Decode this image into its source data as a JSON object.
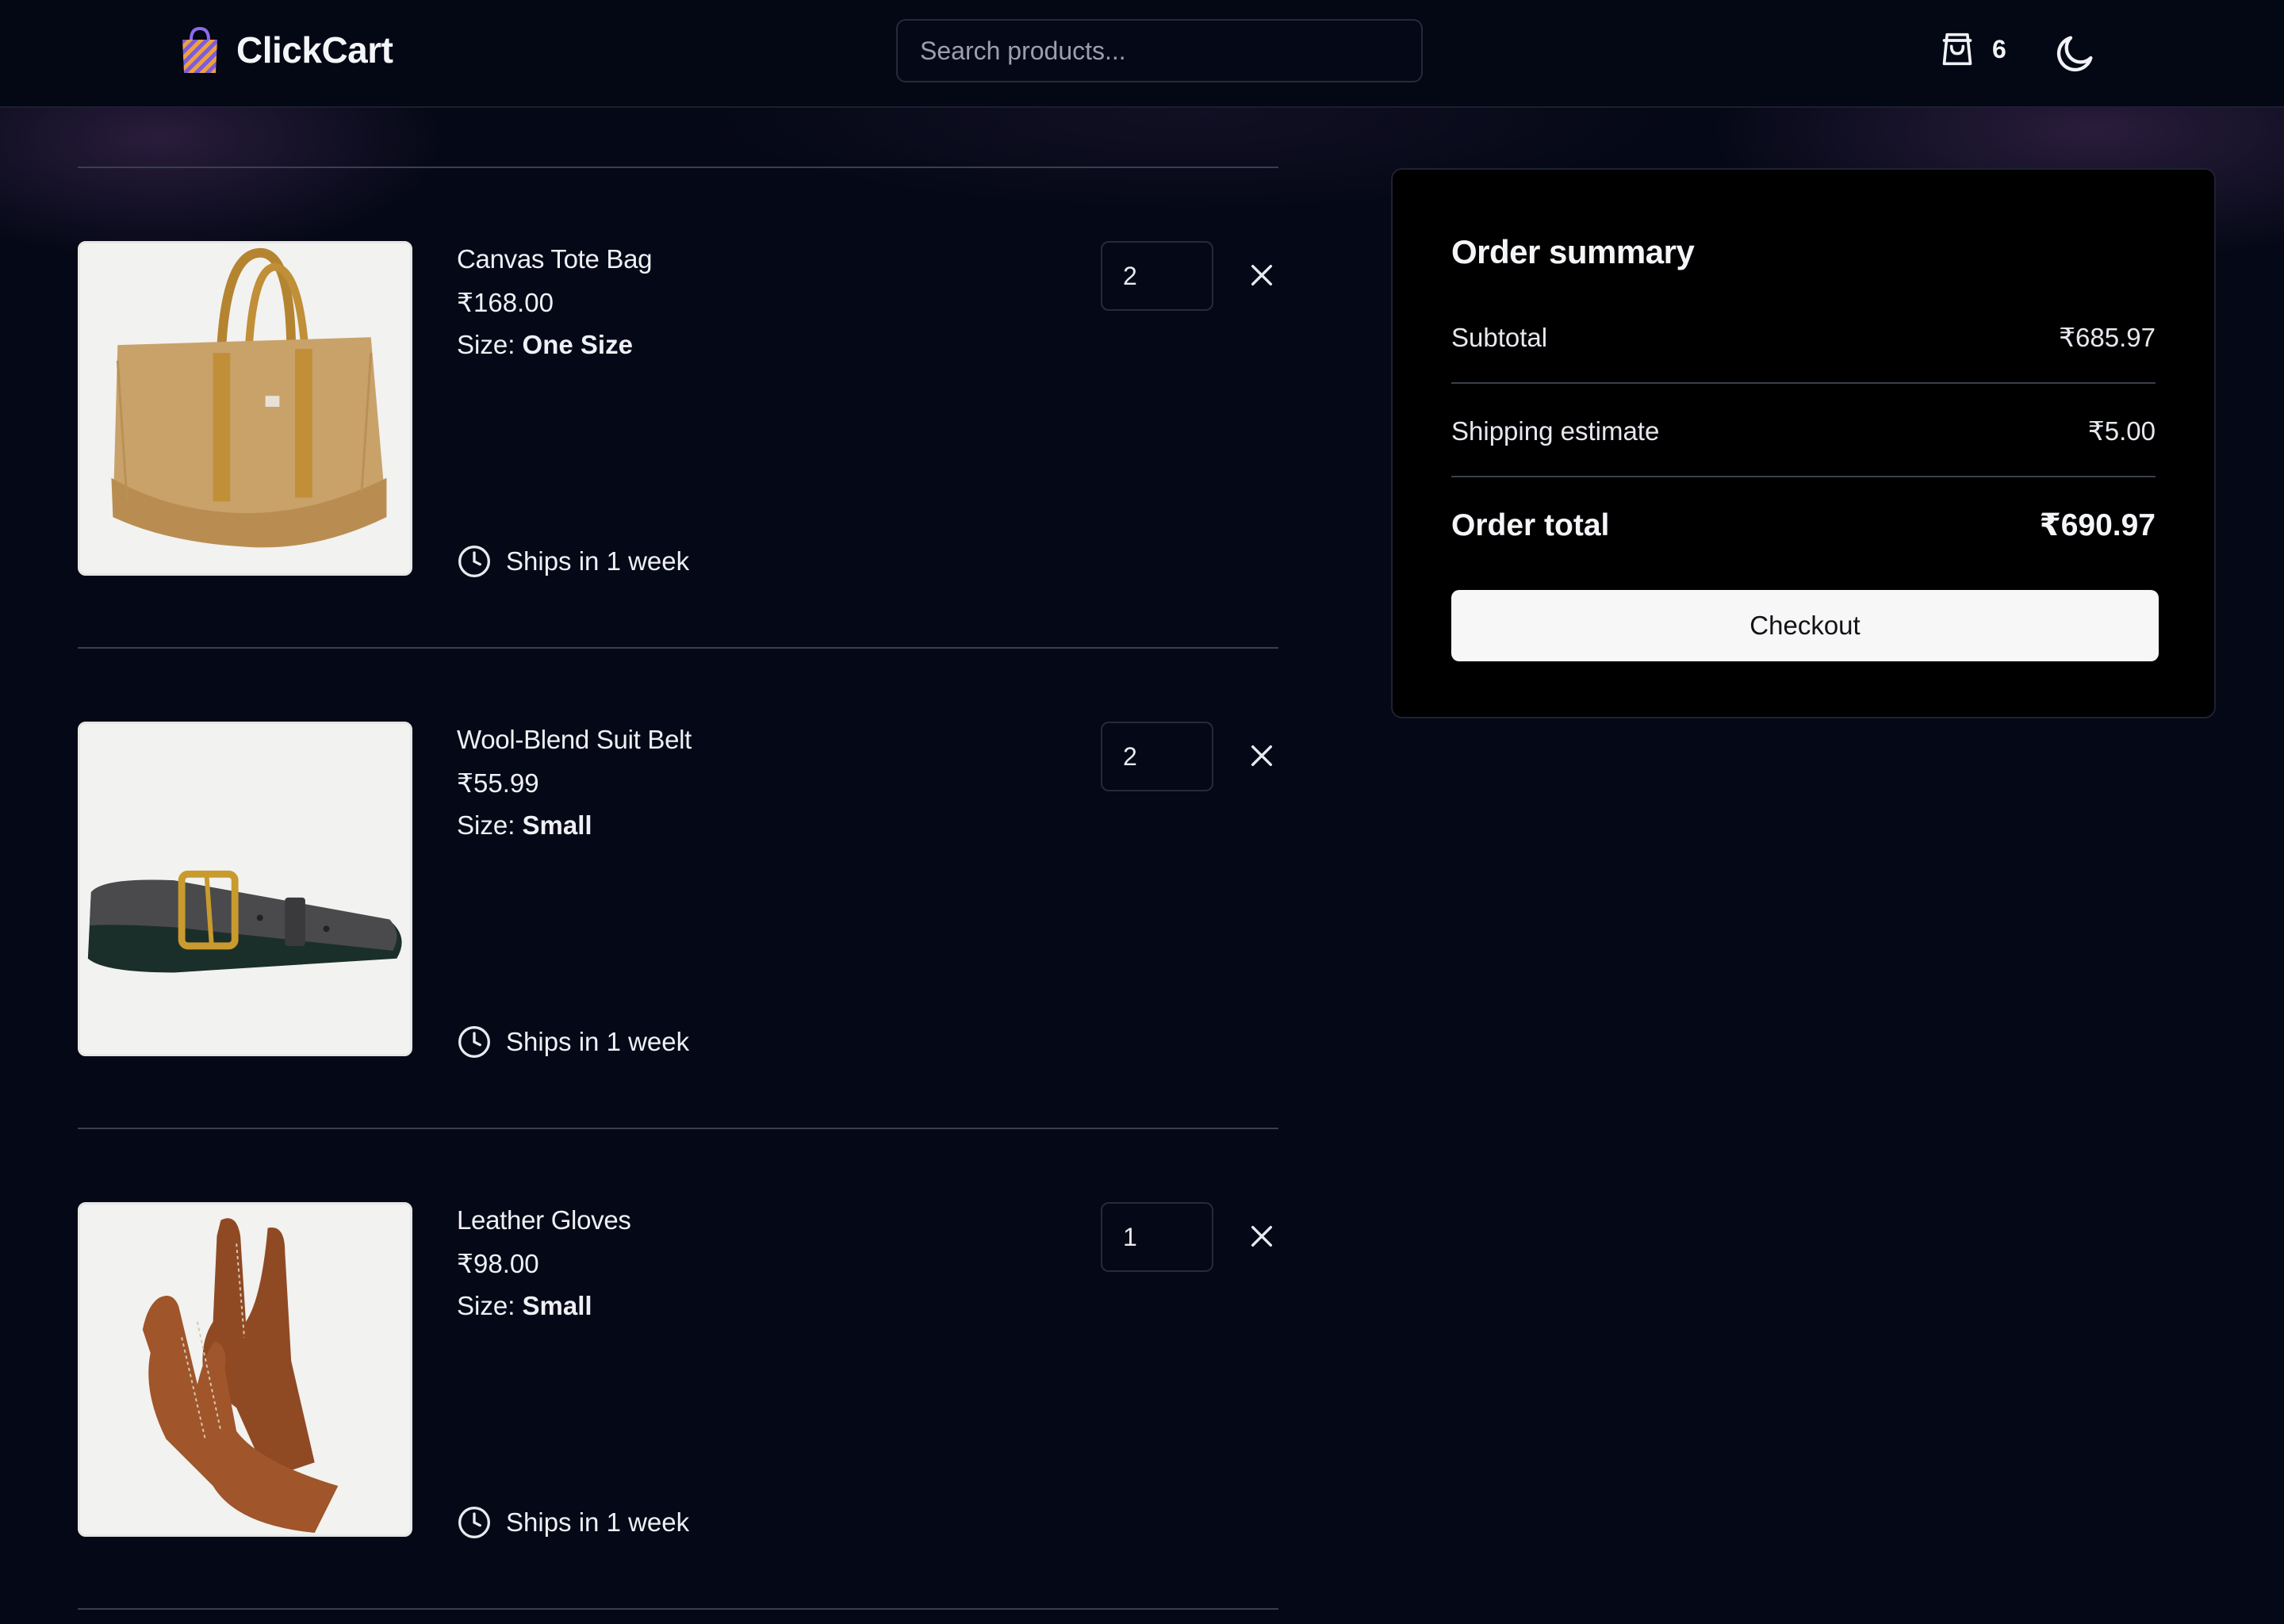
{
  "header": {
    "brand": "ClickCart",
    "search_placeholder": "Search products...",
    "cart_count": "6",
    "theme_icon": "moon-icon"
  },
  "cart": {
    "items": [
      {
        "name": "Canvas Tote Bag",
        "price": "₹168.00",
        "size_label": "Size:",
        "size_value": "One Size",
        "quantity": "2",
        "shipping": "Ships in 1 week"
      },
      {
        "name": "Wool-Blend Suit Belt",
        "price": "₹55.99",
        "size_label": "Size:",
        "size_value": "Small",
        "quantity": "2",
        "shipping": "Ships in 1 week"
      },
      {
        "name": "Leather Gloves",
        "price": "₹98.00",
        "size_label": "Size:",
        "size_value": "Small",
        "quantity": "1",
        "shipping": "Ships in 1 week"
      }
    ]
  },
  "summary": {
    "title": "Order summary",
    "subtotal_label": "Subtotal",
    "subtotal_value": "₹685.97",
    "shipping_label": "Shipping estimate",
    "shipping_value": "₹5.00",
    "total_label": "Order total",
    "total_value": "₹690.97",
    "checkout_label": "Checkout"
  },
  "colors": {
    "background": "#050816",
    "header": "#040714",
    "summary_panel": "#000000",
    "button": "#f7f7f8",
    "divider": "#3a3f4e"
  }
}
